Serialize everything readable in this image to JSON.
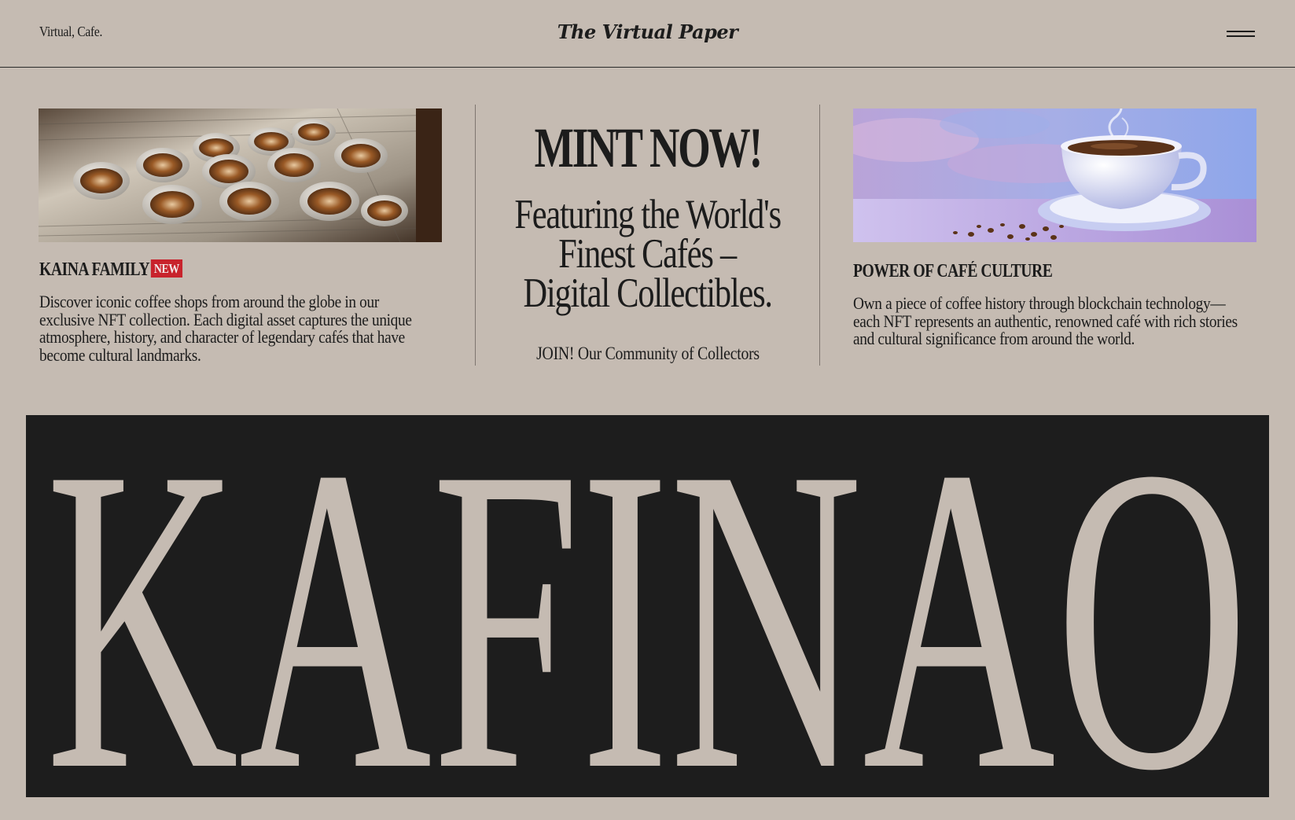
{
  "header": {
    "brand_left": "Virtual, Cafe.",
    "brand_center": "The Virtual Paper",
    "menu_icon": "hamburger-icon"
  },
  "left_card": {
    "title": "KAINA FAMILY",
    "badge": "NEW",
    "description": "Discover iconic coffee shops from around the globe in our exclusive NFT collection. Each digital asset captures the unique atmosphere, history, and character of legendary cafés that have become cultural landmarks."
  },
  "center": {
    "cta_title": "MINT NOW!",
    "tagline_line1": "Featuring the World's",
    "tagline_line2": "Finest Cafés –",
    "tagline_line3": "Digital Collectibles.",
    "join_text": "JOIN! Our Community of Collectors"
  },
  "right_card": {
    "title": "POWER OF CAFÉ CULTURE",
    "description": "Own a piece of coffee history through blockchain technology—each NFT represents an authentic, renowned café with rich stories and cultural significance from around the world."
  },
  "banner": {
    "wordmark": "KAFINAO"
  },
  "colors": {
    "background": "#c5bbb2",
    "ink": "#1c1c1c",
    "banner_bg": "#1d1d1d",
    "badge_red": "#c8232c"
  }
}
